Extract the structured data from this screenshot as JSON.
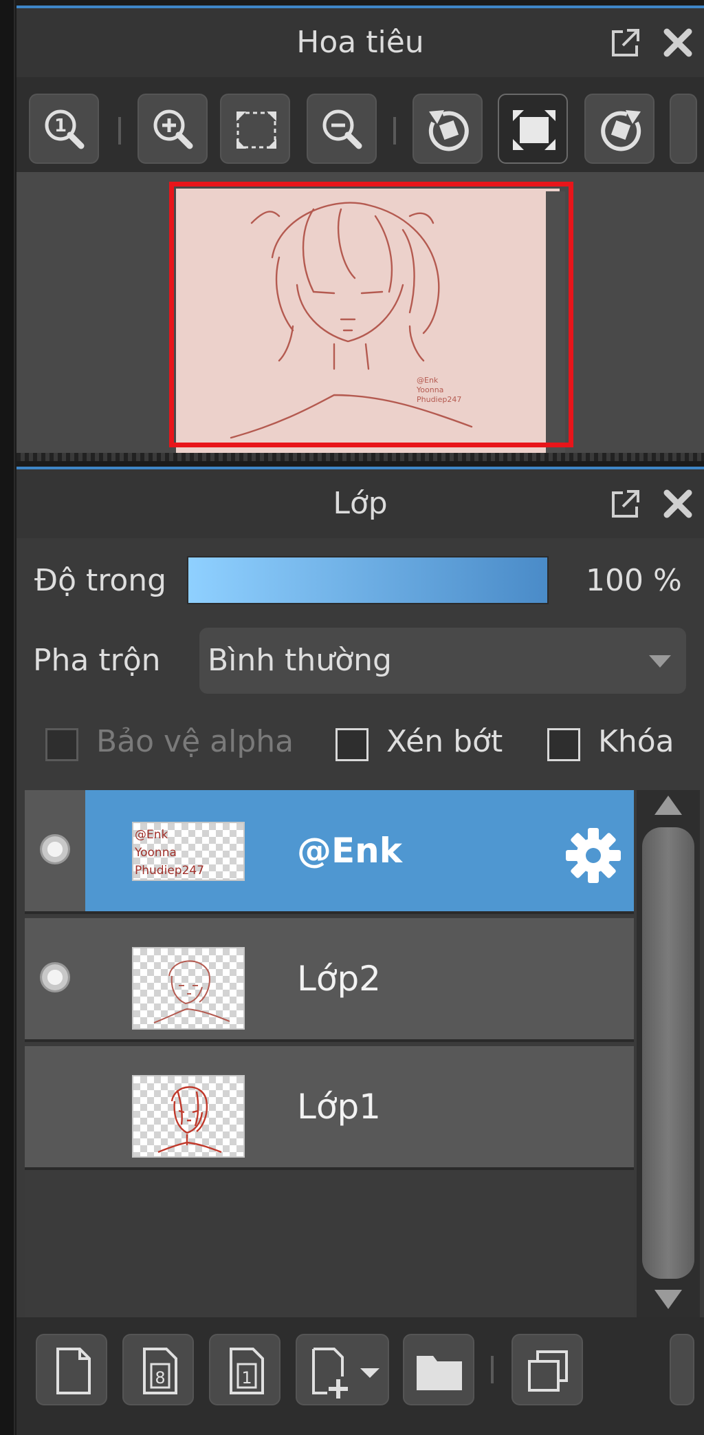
{
  "navigator": {
    "title": "Hoa tiêu",
    "toolbar": [
      {
        "name": "zoom-actual-size-icon"
      },
      {
        "name": "zoom-in-icon"
      },
      {
        "name": "fit-to-window-icon"
      },
      {
        "name": "zoom-out-icon"
      },
      {
        "name": "rotate-left-icon"
      },
      {
        "name": "fullscreen-icon",
        "active": true
      },
      {
        "name": "rotate-right-icon"
      }
    ],
    "view_rect_color": "#e8151a"
  },
  "layers_panel": {
    "title": "Lớp",
    "opacity_label": "Độ trong",
    "opacity_value": "100 %",
    "blend_label": "Pha trộn",
    "blend_value": "Bình thường",
    "protect_alpha_label": "Bảo vệ alpha",
    "clipping_label": "Xén bớt",
    "lock_label": "Khóa",
    "layers": [
      {
        "name": "@Enk",
        "selected": true,
        "visible": true
      },
      {
        "name": "Lớp2",
        "selected": false,
        "visible": true
      },
      {
        "name": "Lớp1",
        "selected": false,
        "visible": false
      }
    ],
    "bottom_tools": [
      "new-layer-icon",
      "new-8bit-layer-icon",
      "new-1bit-layer-icon",
      "add-layer-menu-icon",
      "new-folder-icon",
      "duplicate-layer-icon"
    ],
    "accent_color": "#4f97d1"
  }
}
